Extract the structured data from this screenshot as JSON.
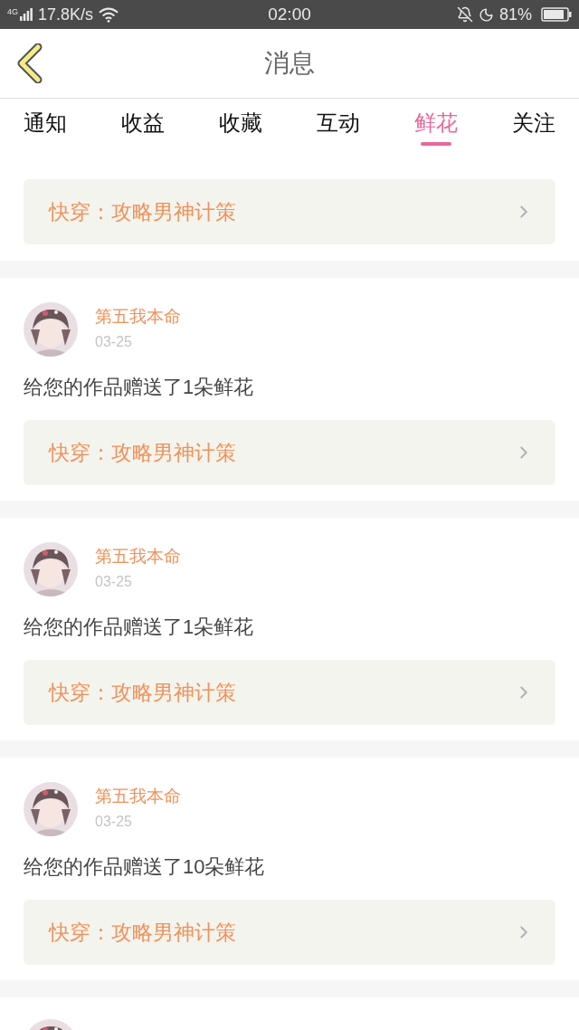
{
  "status_bar": {
    "network": "4G",
    "speed": "17.8K/s",
    "time": "02:00",
    "battery": "81%"
  },
  "header": {
    "title": "消息"
  },
  "tabs": [
    {
      "label": "通知",
      "selected": false
    },
    {
      "label": "收益",
      "selected": false
    },
    {
      "label": "收藏",
      "selected": false
    },
    {
      "label": "互动",
      "selected": false
    },
    {
      "label": "鲜花",
      "selected": true
    },
    {
      "label": "关注",
      "selected": false
    }
  ],
  "messages": [
    {
      "kind": "partial",
      "book": "快穿：攻略男神计策"
    },
    {
      "kind": "full",
      "user": "第五我本命",
      "date": "03-25",
      "text": "给您的作品赠送了1朵鲜花",
      "book": "快穿：攻略男神计策"
    },
    {
      "kind": "full",
      "user": "第五我本命",
      "date": "03-25",
      "text": "给您的作品赠送了1朵鲜花",
      "book": "快穿：攻略男神计策"
    },
    {
      "kind": "full",
      "user": "第五我本命",
      "date": "03-25",
      "text": "给您的作品赠送了10朵鲜花",
      "book": "快穿：攻略男神计策"
    },
    {
      "kind": "cut"
    }
  ]
}
